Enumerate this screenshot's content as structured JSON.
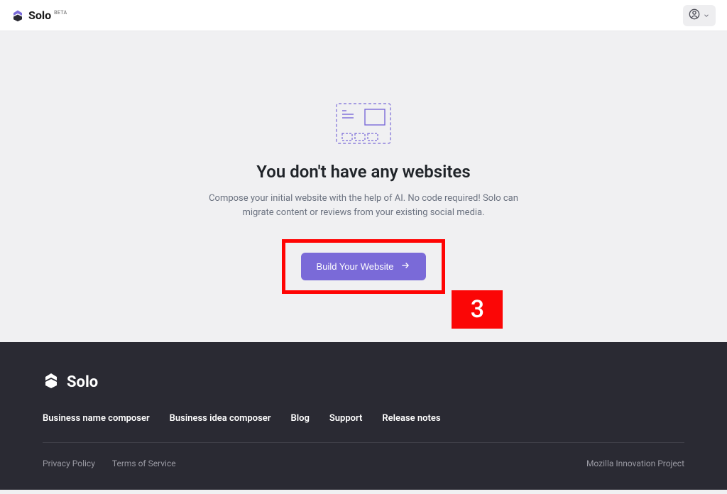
{
  "header": {
    "logo_text": "Solo",
    "logo_badge": "BETA"
  },
  "main": {
    "title": "You don't have any websites",
    "subtitle": "Compose your initial website with the help of AI. No code required! Solo can migrate content or reviews from your existing social media.",
    "cta_label": "Build Your Website"
  },
  "annotation": {
    "number": "3"
  },
  "footer": {
    "logo_text": "Solo",
    "links": [
      "Business name composer",
      "Business idea composer",
      "Blog",
      "Support",
      "Release notes"
    ],
    "legal": [
      "Privacy Policy",
      "Terms of Service"
    ],
    "credit": "Mozilla Innovation Project"
  },
  "colors": {
    "accent": "#7a6ad8",
    "annotation": "#ff0404",
    "footer_bg": "#2a2a33"
  }
}
